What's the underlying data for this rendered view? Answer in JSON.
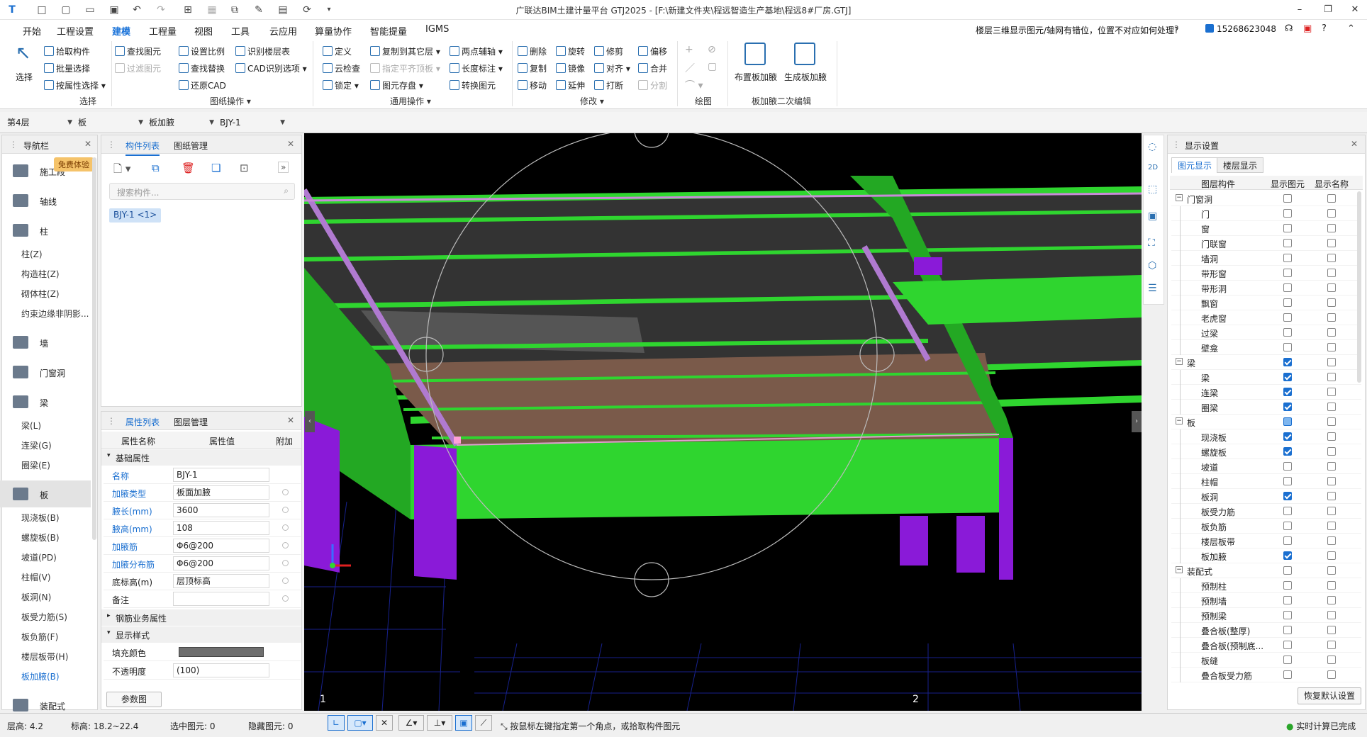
{
  "window": {
    "title": "广联达BIM土建计量平台 GTJ2025 - [F:\\新建文件夹\\程远智造生产基地\\程远8#厂房.GTJ]"
  },
  "menus": [
    "开始",
    "工程设置",
    "建模",
    "工程量",
    "视图",
    "工具",
    "云应用",
    "算量协作",
    "智能提量",
    "IGMS"
  ],
  "menu_active_index": 2,
  "help_question": "楼层三维显示图元/轴网有错位，位置不对应如何处理?",
  "user_phone": "15268623048",
  "ribbon": {
    "select": {
      "big": "选择",
      "items": [
        "拾取构件",
        "批量选择",
        "按属性选择"
      ],
      "group": "选择"
    },
    "drawing": {
      "items": [
        "查找图元",
        "过滤图元",
        "设置比例",
        "查找替换",
        "还原CAD",
        "识别楼层表",
        "CAD识别选项"
      ],
      "group": "图纸操作"
    },
    "common": {
      "items": [
        "定义",
        "云检查",
        "锁定",
        "复制到其它层",
        "指定平齐顶板",
        "图元存盘",
        "两点辅轴",
        "长度标注",
        "转换图元"
      ],
      "group": "通用操作"
    },
    "modify": {
      "items": [
        "删除",
        "旋转",
        "修剪",
        "偏移",
        "复制",
        "镜像",
        "对齐",
        "合并",
        "移动",
        "延伸",
        "打断",
        "分割"
      ],
      "group": "修改"
    },
    "draw": {
      "group": "绘图"
    },
    "haunch": {
      "items": [
        "布置板加腋",
        "生成板加腋"
      ],
      "group": "板加腋二次编辑"
    }
  },
  "selectors": {
    "floor": "第4层",
    "type": "板",
    "subtype": "板加腋",
    "component": "BJY-1"
  },
  "nav": {
    "title": "导航栏",
    "badge": "免费体验",
    "items": [
      {
        "label": "施工段",
        "icon": "construction-icon"
      },
      {
        "label": "轴线",
        "icon": "grid-icon"
      },
      {
        "label": "柱",
        "icon": "column-icon"
      },
      {
        "label": "墙",
        "icon": "wall-icon"
      },
      {
        "label": "门窗洞",
        "icon": "door-window-icon"
      },
      {
        "label": "梁",
        "icon": "beam-icon"
      },
      {
        "label": "板",
        "icon": "slab-icon"
      },
      {
        "label": "装配式",
        "icon": "prefab-icon"
      }
    ],
    "col_subs": [
      "柱(Z)",
      "构造柱(Z)",
      "砌体柱(Z)",
      "约束边缘非阴影..."
    ],
    "beam_subs": [
      "梁(L)",
      "连梁(G)",
      "圈梁(E)"
    ],
    "slab_subs": [
      "现浇板(B)",
      "螺旋板(B)",
      "坡道(PD)",
      "柱帽(V)",
      "板洞(N)",
      "板受力筋(S)",
      "板负筋(F)",
      "楼层板带(H)",
      "板加腋(B)"
    ]
  },
  "component_panel": {
    "tabs": [
      "构件列表",
      "图纸管理"
    ],
    "search_placeholder": "搜索构件...",
    "items": [
      "BJY-1 <1>"
    ]
  },
  "property_panel": {
    "tabs": [
      "属性列表",
      "图层管理"
    ],
    "headers": [
      "属性名称",
      "属性值",
      "附加"
    ],
    "section_basic": "基础属性",
    "rows": [
      {
        "name": "名称",
        "value": "BJY-1",
        "blue": true
      },
      {
        "name": "加腋类型",
        "value": "板面加腋",
        "blue": true
      },
      {
        "name": "腋长(mm)",
        "value": "3600",
        "blue": true
      },
      {
        "name": "腋高(mm)",
        "value": "108",
        "blue": true
      },
      {
        "name": "加腋筋",
        "value": "Φ6@200",
        "blue": true
      },
      {
        "name": "加腋分布筋",
        "value": "Φ6@200",
        "blue": true
      },
      {
        "name": "底标高(m)",
        "value": "层顶标高",
        "blue": false
      },
      {
        "name": "备注",
        "value": "",
        "blue": false
      }
    ],
    "section_rebar": "钢筋业务属性",
    "section_display": "显示样式",
    "fill_color_label": "填充颜色",
    "opacity_label": "不透明度",
    "opacity_value": "(100)",
    "param_button": "参数图"
  },
  "display_settings": {
    "title": "显示设置",
    "tabs": [
      "图元显示",
      "楼层显示"
    ],
    "headers": [
      "图层构件",
      "显示图元",
      "显示名称"
    ],
    "rows": [
      {
        "label": "门窗洞",
        "group": true,
        "show": false,
        "name": false
      },
      {
        "label": "门",
        "show": false,
        "name": false
      },
      {
        "label": "窗",
        "show": false,
        "name": false
      },
      {
        "label": "门联窗",
        "show": false,
        "name": false
      },
      {
        "label": "墙洞",
        "show": false,
        "name": false
      },
      {
        "label": "带形窗",
        "show": false,
        "name": false
      },
      {
        "label": "带形洞",
        "show": false,
        "name": false
      },
      {
        "label": "飘窗",
        "show": false,
        "name": false
      },
      {
        "label": "老虎窗",
        "show": false,
        "name": false
      },
      {
        "label": "过梁",
        "show": false,
        "name": false
      },
      {
        "label": "壁龛",
        "show": false,
        "name": false
      },
      {
        "label": "梁",
        "group": true,
        "show": true,
        "name": false
      },
      {
        "label": "梁",
        "show": true,
        "name": false
      },
      {
        "label": "连梁",
        "show": true,
        "name": false
      },
      {
        "label": "圈梁",
        "show": true,
        "name": false
      },
      {
        "label": "板",
        "group": true,
        "show": "partial",
        "name": false
      },
      {
        "label": "现浇板",
        "show": true,
        "name": false
      },
      {
        "label": "螺旋板",
        "show": true,
        "name": false
      },
      {
        "label": "坡道",
        "show": false,
        "name": false
      },
      {
        "label": "柱帽",
        "show": false,
        "name": false
      },
      {
        "label": "板洞",
        "show": true,
        "name": false
      },
      {
        "label": "板受力筋",
        "show": false,
        "name": false
      },
      {
        "label": "板负筋",
        "show": false,
        "name": false
      },
      {
        "label": "楼层板带",
        "show": false,
        "name": false
      },
      {
        "label": "板加腋",
        "show": true,
        "name": false
      },
      {
        "label": "装配式",
        "group": true,
        "show": false,
        "name": false
      },
      {
        "label": "预制柱",
        "show": false,
        "name": false
      },
      {
        "label": "预制墙",
        "show": false,
        "name": false
      },
      {
        "label": "预制梁",
        "show": false,
        "name": false
      },
      {
        "label": "叠合板(整厚)",
        "show": false,
        "name": false
      },
      {
        "label": "叠合板(预制底...",
        "show": false,
        "name": false
      },
      {
        "label": "板缝",
        "show": false,
        "name": false
      },
      {
        "label": "叠合板受力筋",
        "show": false,
        "name": false
      }
    ],
    "restore_button": "恢复默认设置"
  },
  "viewport": {
    "axis_label_1": "1",
    "axis_label_2": "2"
  },
  "status": {
    "floor_height_label": "层高:",
    "floor_height": "4.2",
    "elevation_label": "标高:",
    "elevation": "18.2~22.4",
    "selected_label": "选中图元:",
    "selected": "0",
    "hidden_label": "隐藏图元:",
    "hidden": "0",
    "hint": "按鼠标左键指定第一个角点，或拾取构件图元",
    "calc": "实时计算已完成"
  },
  "colors": {
    "accent": "#1a6fd0",
    "beam_green": "#2fd52f",
    "column_purple": "#8a1ad8",
    "slab_brown": "#7a5a4a"
  }
}
